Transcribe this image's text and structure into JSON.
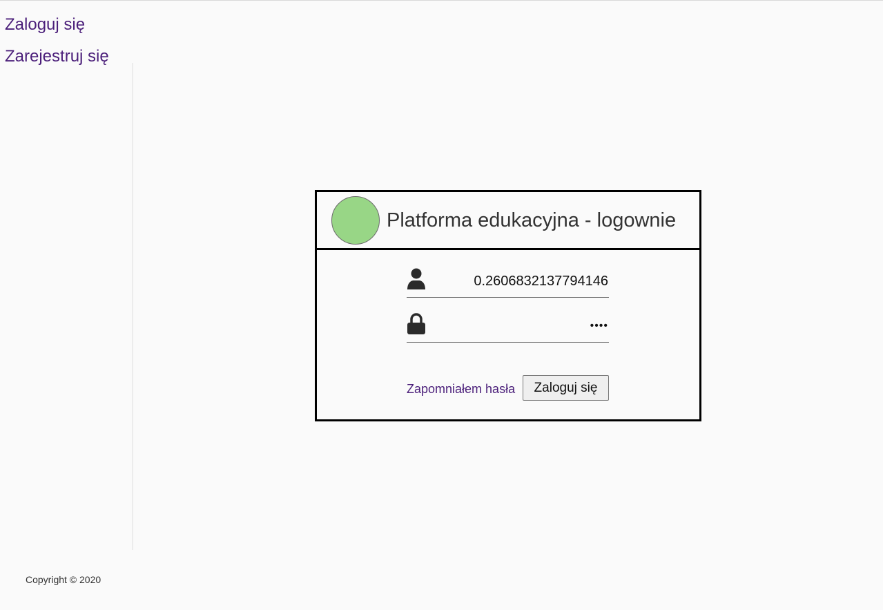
{
  "nav": {
    "login_label": "Zaloguj się",
    "register_label": "Zarejestruj się"
  },
  "login_card": {
    "title": "Platforma edukacyjna - logownie",
    "logo_color": "#98d686",
    "username": {
      "icon": "user-icon",
      "value": "0.2606832137794146",
      "placeholder": ""
    },
    "password": {
      "icon": "lock-icon",
      "value": "abcd",
      "placeholder": ""
    },
    "forgot_password_label": "Zapomniałem hasła",
    "submit_label": "Zaloguj się"
  },
  "footer": {
    "copyright": "Copyright © 2020"
  },
  "colors": {
    "link": "#4b1f7a",
    "border": "#000000",
    "background": "#fafafa"
  }
}
